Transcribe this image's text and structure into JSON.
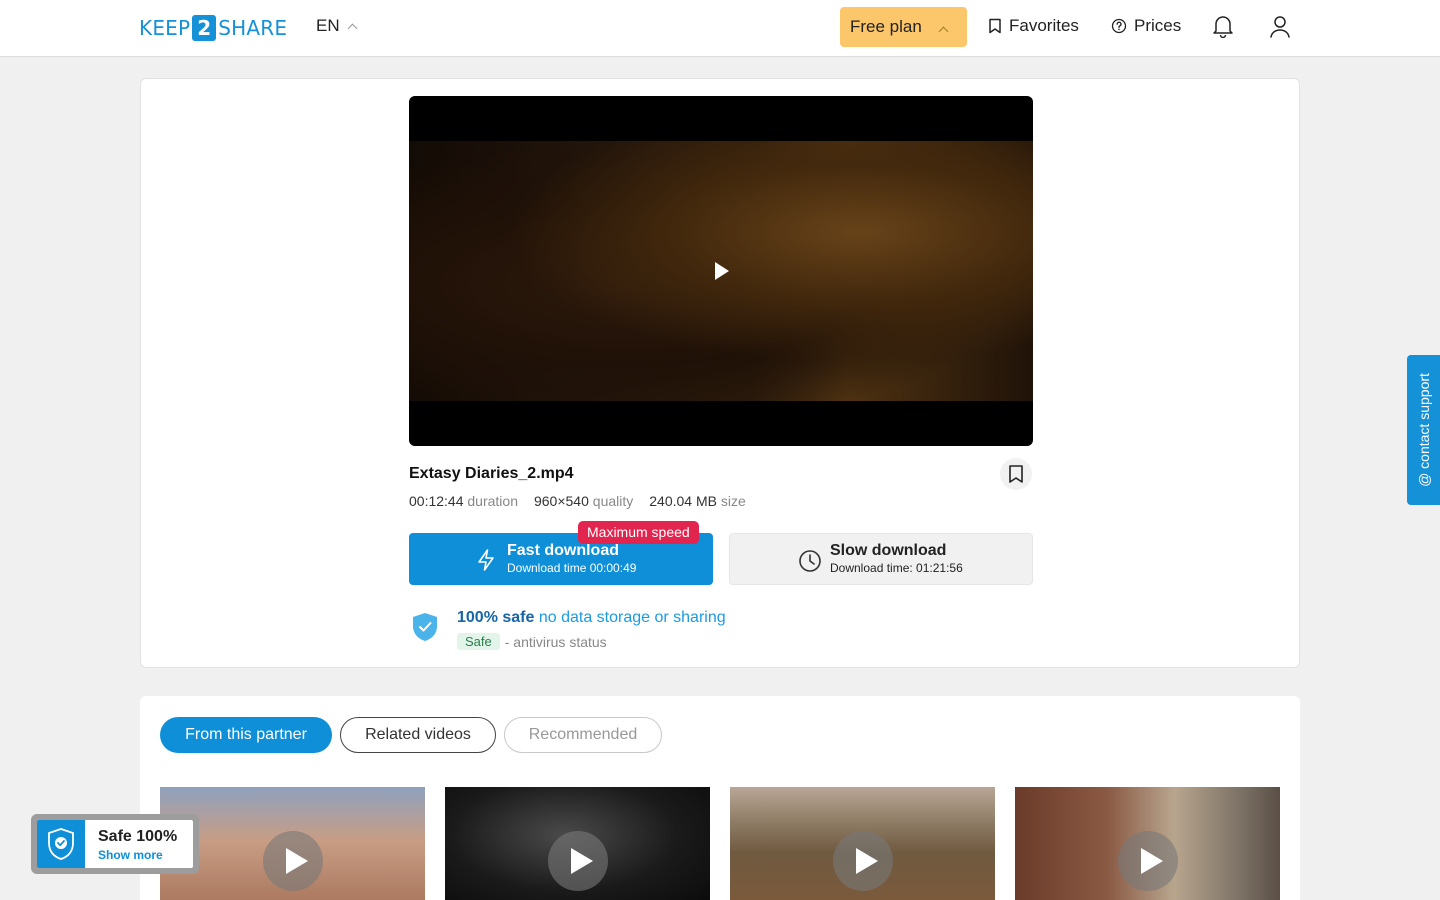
{
  "header": {
    "logo_left": "KEEP",
    "logo_num": "2",
    "logo_right": "SHARE",
    "language": "EN",
    "plan": "Free plan",
    "favorites": "Favorites",
    "prices": "Prices"
  },
  "file": {
    "name": "Extasy Diaries_2.mp4",
    "duration": "00:12:44",
    "duration_label": "duration",
    "quality": "960×540",
    "quality_label": "quality",
    "size": "240.04 MB",
    "size_label": "size"
  },
  "download": {
    "fast_title": "Fast download",
    "fast_sub": "Download time 00:00:49",
    "slow_title": "Slow download",
    "slow_sub": "Download time: 01:21:56",
    "badge": "Maximum speed"
  },
  "safety": {
    "strong": "100% safe",
    "light": "no data storage or sharing",
    "pill": "Safe",
    "status": "- antivirus status"
  },
  "tabs": [
    "From this partner",
    "Related videos",
    "Recommended"
  ],
  "support": "@ contact support",
  "widget": {
    "title": "Safe 100%",
    "link": "Show more"
  },
  "colors": {
    "accent": "#0e8fd8",
    "plan": "#fcc66a",
    "badge": "#e2254f"
  }
}
